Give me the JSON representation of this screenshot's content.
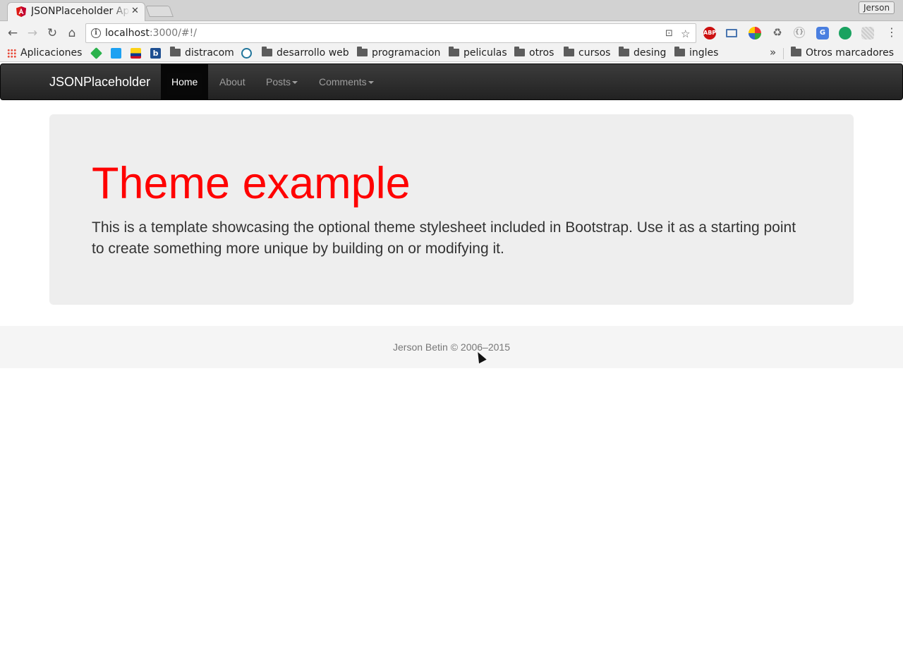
{
  "browser": {
    "tab_title": "JSONPlaceholder App",
    "profile_name": "Jerson",
    "url_host": "localhost",
    "url_rest": ":3000/#!/",
    "bookmarks": [
      {
        "label": "Aplicaciones",
        "icon": "apps-icon"
      },
      {
        "label": "",
        "icon": "feedly-icon"
      },
      {
        "label": "",
        "icon": "twitter-icon"
      },
      {
        "label": "",
        "icon": "colombia-flag-icon"
      },
      {
        "label": "",
        "icon": "b-icon"
      },
      {
        "label": "distracom",
        "icon": "folder-icon"
      },
      {
        "label": "",
        "icon": "wordpress-icon"
      },
      {
        "label": "desarrollo web",
        "icon": "folder-icon"
      },
      {
        "label": "programacion",
        "icon": "folder-icon"
      },
      {
        "label": "peliculas",
        "icon": "folder-icon"
      },
      {
        "label": "otros",
        "icon": "folder-icon"
      },
      {
        "label": "cursos",
        "icon": "folder-icon"
      },
      {
        "label": "desing",
        "icon": "folder-icon"
      },
      {
        "label": "ingles",
        "icon": "folder-icon"
      }
    ],
    "more_bookmarks": "»",
    "other_bookmarks": "Otros marcadores"
  },
  "navbar": {
    "brand": "JSONPlaceholder",
    "items": [
      {
        "label": "Home",
        "active": true
      },
      {
        "label": "About"
      },
      {
        "label": "Posts",
        "dropdown": true
      },
      {
        "label": "Comments",
        "dropdown": true
      }
    ]
  },
  "jumbotron": {
    "title": "Theme example",
    "text": "This is a template showcasing the optional theme stylesheet included in Bootstrap. Use it as a starting point to create something more unique by building on or modifying it."
  },
  "footer": {
    "text": "Jerson Betin © 2006–2015"
  },
  "colors": {
    "title": "#ff0000",
    "navbar_bg": "#222222",
    "jumbotron_bg": "#eeeeee"
  }
}
